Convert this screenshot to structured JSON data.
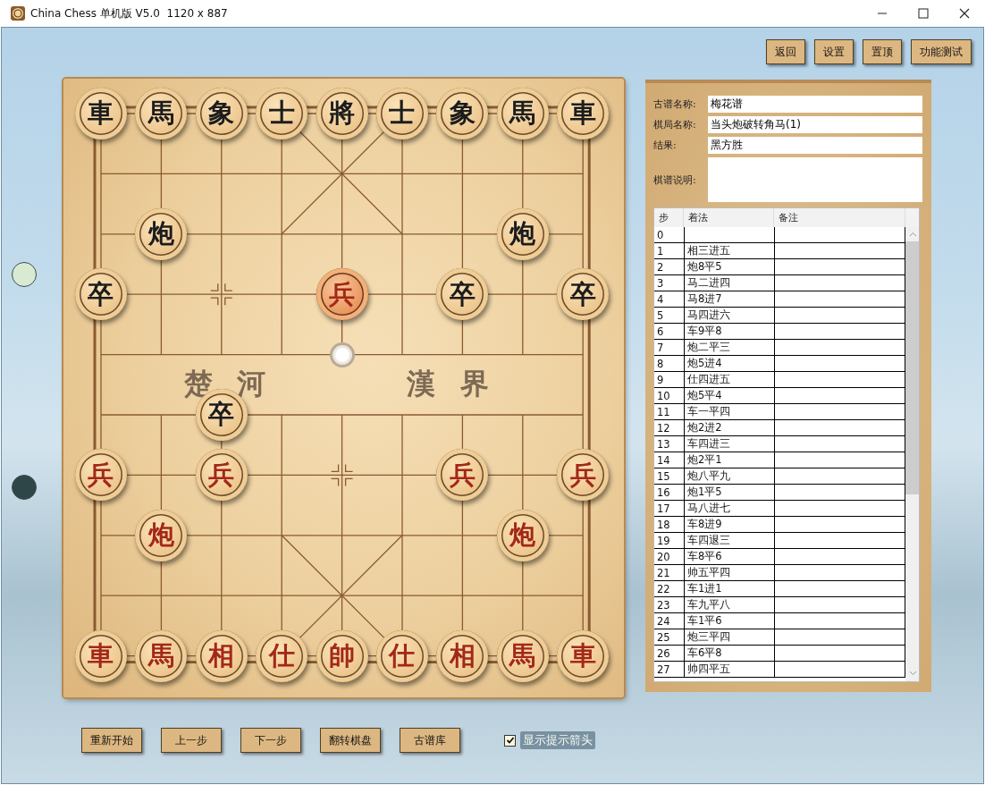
{
  "window": {
    "title": "China Chess 单机版 V5.0  1120 x 887"
  },
  "top_buttons": [
    "返回",
    "设置",
    "置顶",
    "功能测试"
  ],
  "turn_indicators": [
    {
      "color": "#d8ead2"
    },
    {
      "color": "#2e4648"
    }
  ],
  "board": {
    "river": [
      "楚 河",
      "漢 界"
    ],
    "rows": [
      {
        "cells": [
          {
            "kind": "piece",
            "is_red": false,
            "piece": "車",
            "selected": false
          },
          {
            "kind": "piece",
            "is_red": false,
            "piece": "馬",
            "selected": false
          },
          {
            "kind": "piece",
            "is_red": false,
            "piece": "象",
            "selected": false
          },
          {
            "kind": "piece",
            "is_red": false,
            "piece": "士",
            "selected": false
          },
          {
            "kind": "piece",
            "is_red": false,
            "piece": "將",
            "selected": false
          },
          {
            "kind": "piece",
            "is_red": false,
            "piece": "士",
            "selected": false
          },
          {
            "kind": "piece",
            "is_red": false,
            "piece": "象",
            "selected": false
          },
          {
            "kind": "piece",
            "is_red": false,
            "piece": "馬",
            "selected": false
          },
          {
            "kind": "piece",
            "is_red": false,
            "piece": "車",
            "selected": false
          }
        ]
      },
      {
        "cells": [
          {
            "kind": "empty"
          },
          {
            "kind": "empty"
          },
          {
            "kind": "empty"
          },
          {
            "kind": "empty"
          },
          {
            "kind": "empty"
          },
          {
            "kind": "empty"
          },
          {
            "kind": "empty"
          },
          {
            "kind": "empty"
          },
          {
            "kind": "empty"
          }
        ]
      },
      {
        "cells": [
          {
            "kind": "empty"
          },
          {
            "kind": "piece",
            "is_red": false,
            "piece": "炮",
            "selected": false
          },
          {
            "kind": "empty"
          },
          {
            "kind": "empty"
          },
          {
            "kind": "empty"
          },
          {
            "kind": "empty"
          },
          {
            "kind": "empty"
          },
          {
            "kind": "piece",
            "is_red": false,
            "piece": "炮",
            "selected": false
          },
          {
            "kind": "empty"
          }
        ]
      },
      {
        "cells": [
          {
            "kind": "piece",
            "is_red": false,
            "piece": "卒",
            "selected": false
          },
          {
            "kind": "empty"
          },
          {
            "kind": "empty"
          },
          {
            "kind": "empty"
          },
          {
            "kind": "piece",
            "is_red": true,
            "piece": "兵",
            "selected": true
          },
          {
            "kind": "empty"
          },
          {
            "kind": "piece",
            "is_red": false,
            "piece": "卒",
            "selected": false
          },
          {
            "kind": "empty"
          },
          {
            "kind": "piece",
            "is_red": false,
            "piece": "卒",
            "selected": false
          }
        ]
      },
      {
        "cells": [
          {
            "kind": "empty"
          },
          {
            "kind": "empty"
          },
          {
            "kind": "empty"
          },
          {
            "kind": "empty"
          },
          {
            "kind": "hint"
          },
          {
            "kind": "empty"
          },
          {
            "kind": "empty"
          },
          {
            "kind": "empty"
          },
          {
            "kind": "empty"
          }
        ]
      },
      {
        "cells": [
          {
            "kind": "empty"
          },
          {
            "kind": "empty"
          },
          {
            "kind": "piece",
            "is_red": false,
            "piece": "卒",
            "selected": false
          },
          {
            "kind": "empty"
          },
          {
            "kind": "empty"
          },
          {
            "kind": "empty"
          },
          {
            "kind": "empty"
          },
          {
            "kind": "empty"
          },
          {
            "kind": "empty"
          }
        ]
      },
      {
        "cells": [
          {
            "kind": "piece",
            "is_red": true,
            "piece": "兵",
            "selected": false
          },
          {
            "kind": "empty"
          },
          {
            "kind": "piece",
            "is_red": true,
            "piece": "兵",
            "selected": false
          },
          {
            "kind": "empty"
          },
          {
            "kind": "empty"
          },
          {
            "kind": "empty"
          },
          {
            "kind": "piece",
            "is_red": true,
            "piece": "兵",
            "selected": false
          },
          {
            "kind": "empty"
          },
          {
            "kind": "piece",
            "is_red": true,
            "piece": "兵",
            "selected": false
          }
        ]
      },
      {
        "cells": [
          {
            "kind": "empty"
          },
          {
            "kind": "piece",
            "is_red": true,
            "piece": "炮",
            "selected": false
          },
          {
            "kind": "empty"
          },
          {
            "kind": "empty"
          },
          {
            "kind": "empty"
          },
          {
            "kind": "empty"
          },
          {
            "kind": "empty"
          },
          {
            "kind": "piece",
            "is_red": true,
            "piece": "炮",
            "selected": false
          },
          {
            "kind": "empty"
          }
        ]
      },
      {
        "cells": [
          {
            "kind": "empty"
          },
          {
            "kind": "empty"
          },
          {
            "kind": "empty"
          },
          {
            "kind": "empty"
          },
          {
            "kind": "empty"
          },
          {
            "kind": "empty"
          },
          {
            "kind": "empty"
          },
          {
            "kind": "empty"
          },
          {
            "kind": "empty"
          }
        ]
      },
      {
        "cells": [
          {
            "kind": "piece",
            "is_red": true,
            "piece": "車",
            "selected": false
          },
          {
            "kind": "piece",
            "is_red": true,
            "piece": "馬",
            "selected": false
          },
          {
            "kind": "piece",
            "is_red": true,
            "piece": "相",
            "selected": false
          },
          {
            "kind": "piece",
            "is_red": true,
            "piece": "仕",
            "selected": false
          },
          {
            "kind": "piece",
            "is_red": true,
            "piece": "帥",
            "selected": false
          },
          {
            "kind": "piece",
            "is_red": true,
            "piece": "仕",
            "selected": false
          },
          {
            "kind": "piece",
            "is_red": true,
            "piece": "相",
            "selected": false
          },
          {
            "kind": "piece",
            "is_red": true,
            "piece": "馬",
            "selected": false
          },
          {
            "kind": "piece",
            "is_red": true,
            "piece": "車",
            "selected": false
          }
        ]
      }
    ]
  },
  "game_info": {
    "fields": [
      {
        "kind": "text",
        "label": "古谱名称:",
        "value": "梅花谱"
      },
      {
        "kind": "text",
        "label": "棋局名称:",
        "value": "当头炮破转角马(1)"
      },
      {
        "kind": "text",
        "label": "结果:",
        "value": "黑方胜"
      },
      {
        "kind": "multiline",
        "label": "棋谱说明:"
      }
    ]
  },
  "moves": {
    "columns": [
      "步",
      "着法",
      "备注"
    ],
    "rows": [
      {
        "step": "0"
      },
      {
        "step": "1",
        "move": "相三进五"
      },
      {
        "step": "2",
        "move": "炮8平5"
      },
      {
        "step": "3",
        "move": "马二进四"
      },
      {
        "step": "4",
        "move": "马8进7"
      },
      {
        "step": "5",
        "move": "马四进六"
      },
      {
        "step": "6",
        "move": "车9平8"
      },
      {
        "step": "7",
        "move": "炮二平三"
      },
      {
        "step": "8",
        "move": "炮5进4"
      },
      {
        "step": "9",
        "move": "仕四进五"
      },
      {
        "step": "10",
        "move": "炮5平4"
      },
      {
        "step": "11",
        "move": "车一平四"
      },
      {
        "step": "12",
        "move": "炮2进2"
      },
      {
        "step": "13",
        "move": "车四进三"
      },
      {
        "step": "14",
        "move": "炮2平1"
      },
      {
        "step": "15",
        "move": "炮八平九"
      },
      {
        "step": "16",
        "move": "炮1平5"
      },
      {
        "step": "17",
        "move": "马八进七"
      },
      {
        "step": "18",
        "move": "车8进9"
      },
      {
        "step": "19",
        "move": "车四退三"
      },
      {
        "step": "20",
        "move": "车8平6"
      },
      {
        "step": "21",
        "move": "帅五平四"
      },
      {
        "step": "22",
        "move": "车1进1"
      },
      {
        "step": "23",
        "move": "车九平八"
      },
      {
        "step": "24",
        "move": "车1平6"
      },
      {
        "step": "25",
        "move": "炮三平四"
      },
      {
        "step": "26",
        "move": "车6平8"
      },
      {
        "step": "27",
        "move": "帅四平五"
      }
    ]
  },
  "bottom_buttons": [
    "重新开始",
    "上一步",
    "下一步",
    "翻转棋盘",
    "古谱库"
  ],
  "hint_checkbox": {
    "label": "显示提示箭头",
    "checked": true
  }
}
